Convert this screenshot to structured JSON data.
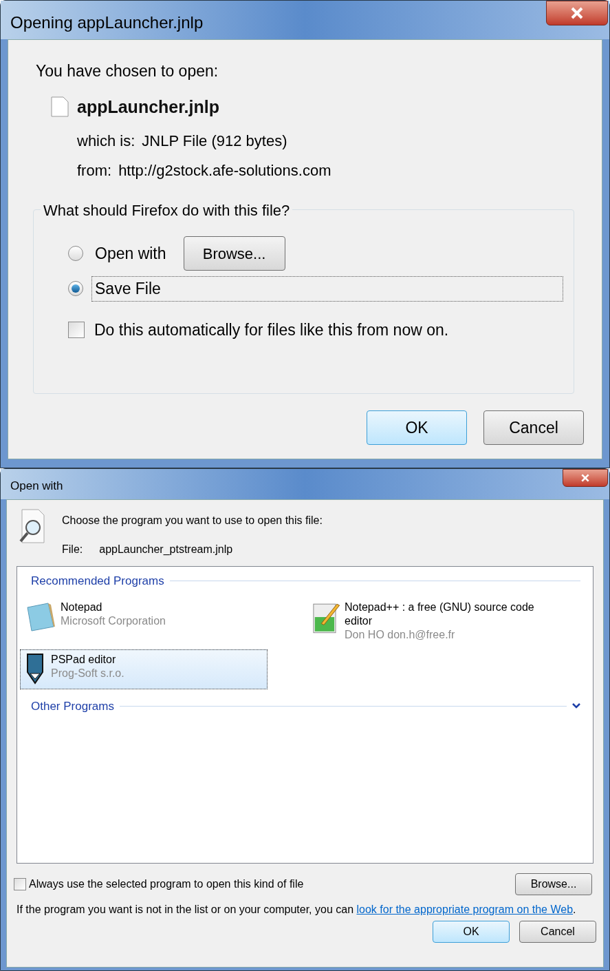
{
  "download_dialog": {
    "title": "Opening appLauncher.jnlp",
    "intro": "You have chosen to open:",
    "file_name": "appLauncher.jnlp",
    "type_label": "which is:",
    "type_value": "JNLP File (912 bytes)",
    "from_label": "from:",
    "from_value": "http://g2stock.afe-solutions.com",
    "group_title": "What should Firefox do with this file?",
    "options": [
      {
        "label": "Open with",
        "selected": false
      },
      {
        "label": "Save File",
        "selected": true
      }
    ],
    "browse_button": "Browse...",
    "auto_checkbox": {
      "label": "Do this automatically for files like this from now on.",
      "checked": false
    },
    "buttons": [
      "OK",
      "Cancel"
    ]
  },
  "open_with_dialog": {
    "title": "Open with",
    "prompt": "Choose the program you want to use to open this file:",
    "file_label": "File:",
    "file_value": "appLauncher_ptstream.jnlp",
    "recommended_heading": "Recommended Programs",
    "programs": [
      {
        "name": "Notepad",
        "publisher": "Microsoft Corporation",
        "selected": false
      },
      {
        "name": "Notepad++ : a free (GNU) source code editor",
        "publisher": "Don HO don.h@free.fr",
        "selected": false
      },
      {
        "name": "PSPad editor",
        "publisher": "Prog-Soft s.r.o.",
        "selected": true
      }
    ],
    "other_heading": "Other Programs",
    "always_checkbox": {
      "label": "Always use the selected program to open this kind of file",
      "checked": false
    },
    "browse_button": "Browse...",
    "help_text": "If the program you want is not in the list or on your computer, you can",
    "help_link": "look for the appropriate program on the Web",
    "help_end": ".",
    "buttons": [
      "OK",
      "Cancel"
    ]
  }
}
